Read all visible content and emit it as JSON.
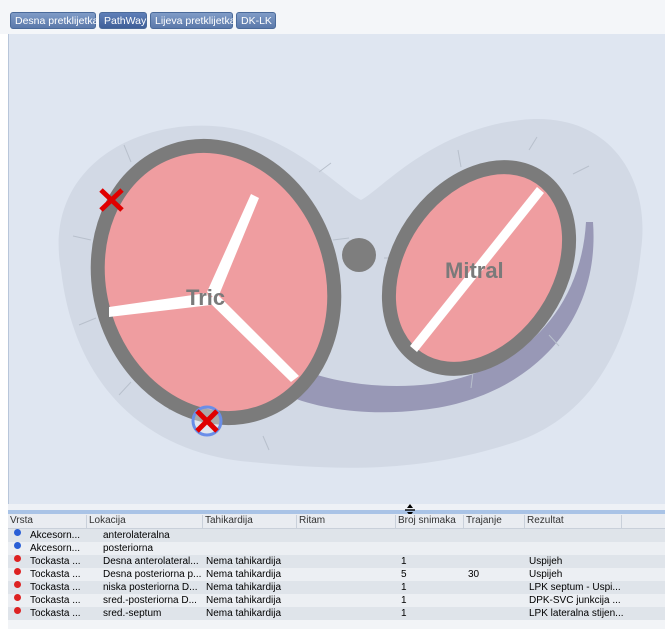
{
  "tabs": [
    {
      "label": "Desna pretklijetka"
    },
    {
      "label": "PathWay"
    },
    {
      "label": "Lijeva pretklijetka"
    },
    {
      "label": "DK-LK"
    }
  ],
  "diagram": {
    "tricuspid_label": "Tric",
    "mitral_label": "Mitral"
  },
  "table": {
    "columns": [
      "Vrsta",
      "Lokacija",
      "Tahikardija",
      "Ritam",
      "Broj snimaka",
      "Trajanje",
      "Rezultat"
    ],
    "rows": [
      {
        "status": "blue",
        "vrsta": "Akcesorn...",
        "lokacija": "anterolateralna",
        "tahikardija": "",
        "ritam": "",
        "broj": "",
        "trajanje": "",
        "rezultat": ""
      },
      {
        "status": "blue",
        "vrsta": "Akcesorn...",
        "lokacija": "posteriorna",
        "tahikardija": "",
        "ritam": "",
        "broj": "",
        "trajanje": "",
        "rezultat": ""
      },
      {
        "status": "red",
        "vrsta": "Tockasta ...",
        "lokacija": "Desna anterolateral...",
        "tahikardija": "Nema tahikardija",
        "ritam": "",
        "broj": "1",
        "trajanje": "",
        "rezultat": "Uspijeh"
      },
      {
        "status": "red",
        "vrsta": "Tockasta ...",
        "lokacija": "Desna posteriorna p...",
        "tahikardija": "Nema tahikardija",
        "ritam": "",
        "broj": "5",
        "trajanje": "30",
        "rezultat": "Uspijeh"
      },
      {
        "status": "red",
        "vrsta": "Tockasta ...",
        "lokacija": "niska posteriorna D...",
        "tahikardija": "Nema tahikardija",
        "ritam": "",
        "broj": "1",
        "trajanje": "",
        "rezultat": "LPK septum - Uspi..."
      },
      {
        "status": "red",
        "vrsta": "Tockasta ...",
        "lokacija": "sred.-posteriorna D...",
        "tahikardija": "Nema tahikardija",
        "ritam": "",
        "broj": "1",
        "trajanje": "",
        "rezultat": "DPK-SVC junkcija ..."
      },
      {
        "status": "red",
        "vrsta": "Tockasta ...",
        "lokacija": "sred.-septum",
        "tahikardija": "Nema tahikardija",
        "ritam": "",
        "broj": "1",
        "trajanje": "",
        "rezultat": "LPK lateralna stijen..."
      }
    ]
  },
  "colors": {
    "valve_fill": "#ef9da0",
    "ring": "#7b7b7b",
    "marker": "#e00000",
    "highlight_ring": "#6a8ee8"
  },
  "icons": {
    "resize": "resize-vertical-icon",
    "marker": "x-marker-icon"
  }
}
